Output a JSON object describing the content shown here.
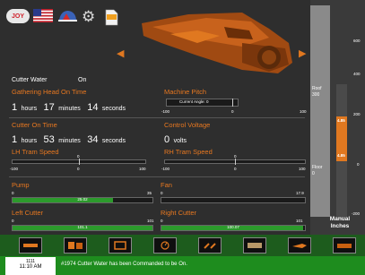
{
  "toolbar": {
    "logo_text": "JOY",
    "icons": [
      "logo-icon",
      "us-flag-icon",
      "helmet-icon",
      "gear-icon",
      "document-icon"
    ]
  },
  "cutter_water": {
    "label": "Cutter Water",
    "value": "On"
  },
  "gathering_head": {
    "label": "Gathering Head On Time",
    "hours": "1",
    "hours_unit": "hours",
    "minutes": "17",
    "minutes_unit": "minutes",
    "seconds": "14",
    "seconds_unit": "seconds"
  },
  "machine_pitch": {
    "label": "Machine Pitch",
    "caption": "Current Angle: 0",
    "min": "-100",
    "mid": "0",
    "max": "100",
    "value": 0
  },
  "cutter_on_time": {
    "label": "Cutter On Time",
    "hours": "1",
    "hours_unit": "hours",
    "minutes": "53",
    "minutes_unit": "minutes",
    "seconds": "34",
    "seconds_unit": "seconds"
  },
  "control_voltage": {
    "label": "Control Voltage",
    "value": "0",
    "unit": "volts"
  },
  "lh_tram": {
    "label": "LH Tram Speed",
    "min": "-100",
    "mid": "0",
    "max": "100",
    "value": 0
  },
  "rh_tram": {
    "label": "RH Tram Speed",
    "min": "-100",
    "mid": "0",
    "max": "100",
    "value": 0
  },
  "pump": {
    "label": "Pump",
    "min": "0",
    "max": "35",
    "value": "25.02",
    "fraction": 0.715
  },
  "fan": {
    "label": "Fan",
    "min": "0",
    "max": "17.9",
    "value": "",
    "fraction": 0
  },
  "left_cutter": {
    "label": "Left Cutter",
    "min": "0",
    "max": "101",
    "value": "101.1",
    "fraction": 1.0
  },
  "right_cutter": {
    "label": "Right Cutter",
    "min": "0",
    "max": "101",
    "value": "100.07",
    "fraction": 0.99
  },
  "gauge": {
    "roof_label": "Roof",
    "roof_value": "300",
    "floor_label": "Floor",
    "floor_value": "0",
    "reading_top": "4.85",
    "reading_bottom": "4.85",
    "ticks": [
      "600",
      "400",
      "200",
      "0",
      "-200"
    ],
    "mode_label_1": "Manual",
    "mode_label_2": "Inches"
  },
  "bottom_buttons": [
    "machine-icon",
    "boxes-icon",
    "monitor-icon",
    "gauge-icon",
    "tools-icon",
    "conveyor-icon",
    "cutter-icon",
    "miner-icon"
  ],
  "status": {
    "date": "1111",
    "time": "11:10 AM",
    "message": "#1974 Cutter Water has been Commanded to be On."
  },
  "colors": {
    "accent": "#e87820",
    "green_bar": "#2c9a2c",
    "status_green": "#1e8c1e"
  }
}
